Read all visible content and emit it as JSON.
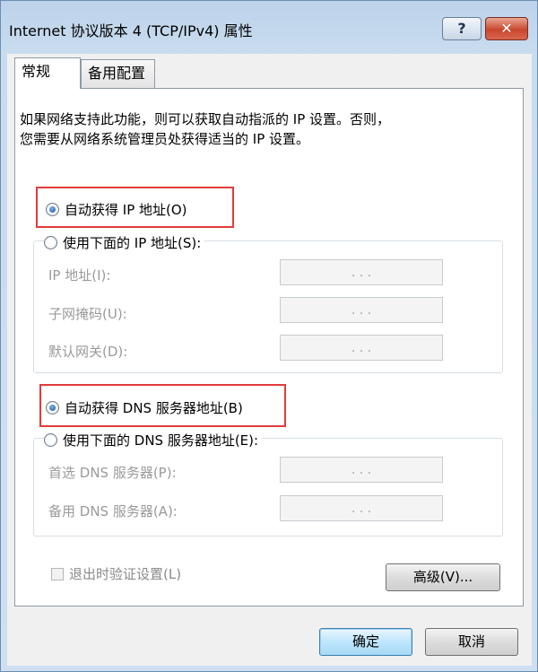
{
  "window": {
    "title": "Internet 协议版本 4 (TCP/IPv4) 属性",
    "help_label": "?",
    "close_label": "✕"
  },
  "tabs": [
    {
      "label": "常规"
    },
    {
      "label": "备用配置"
    }
  ],
  "description": {
    "line1": "如果网络支持此功能，则可以获取自动指派的 IP 设置。否则，",
    "line2": "您需要从网络系统管理员处获得适当的 IP 设置。"
  },
  "ip_section": {
    "auto_label": "自动获得 IP 地址(O)",
    "auto_selected": true,
    "manual_label": "使用下面的 IP 地址(S):",
    "fields": [
      {
        "label": "IP 地址(I):",
        "value": ".  .  ."
      },
      {
        "label": "子网掩码(U):",
        "value": ".  .  ."
      },
      {
        "label": "默认网关(D):",
        "value": ".  .  ."
      }
    ]
  },
  "dns_section": {
    "auto_label": "自动获得 DNS 服务器地址(B)",
    "auto_selected": true,
    "manual_label": "使用下面的 DNS 服务器地址(E):",
    "fields": [
      {
        "label": "首选 DNS 服务器(P):",
        "value": ".  .  ."
      },
      {
        "label": "备用 DNS 服务器(A):",
        "value": ".  .  ."
      }
    ]
  },
  "validate_label": "退出时验证设置(L)",
  "advanced_label": "高级(V)...",
  "ok_label": "确定",
  "cancel_label": "取消",
  "colors": {
    "highlight": "#e23b3b",
    "disabled_text": "#9a9a9a",
    "title_bar": "#bdd3ea"
  }
}
